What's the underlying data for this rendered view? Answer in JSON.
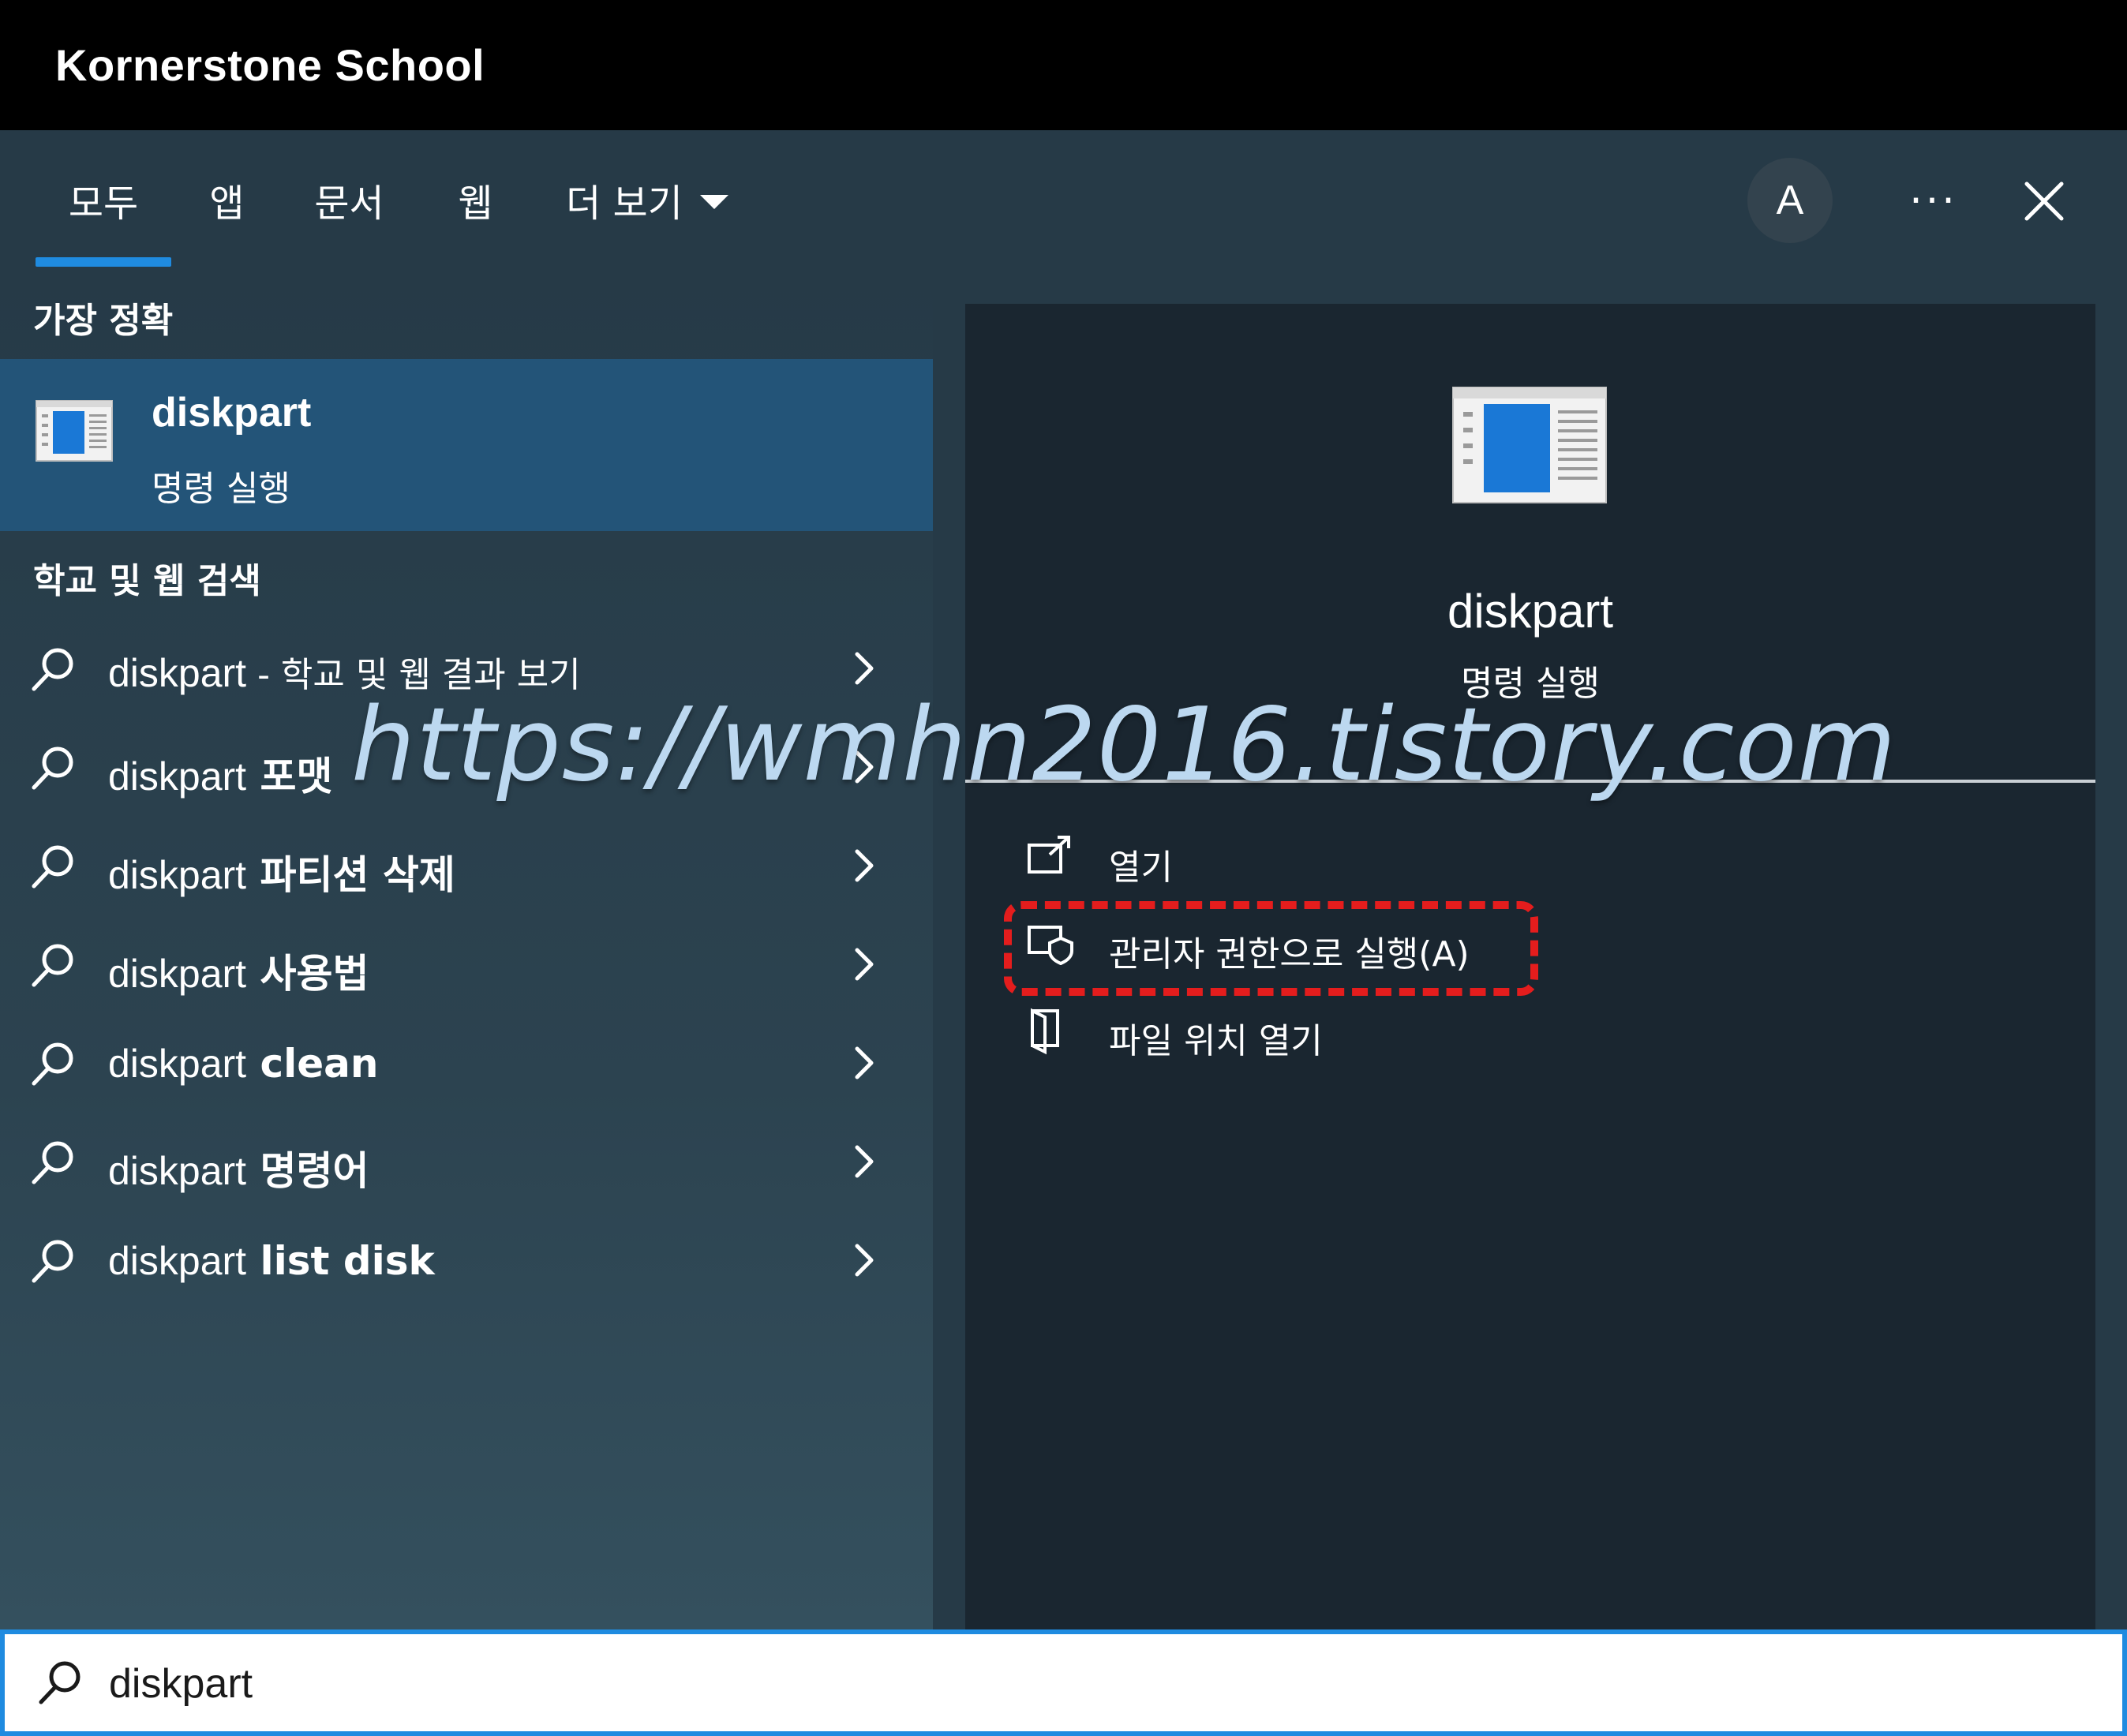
{
  "window": {
    "title": "Kornerstone School"
  },
  "tabs": [
    {
      "label": "모두",
      "active": true
    },
    {
      "label": "앱"
    },
    {
      "label": "문서"
    },
    {
      "label": "웹"
    },
    {
      "label": "더 보기",
      "has_dropdown": true
    }
  ],
  "header": {
    "avatar_initial": "A",
    "more_label": "···"
  },
  "best_match": {
    "heading": "가장 정확",
    "name": "diskpart",
    "subtitle": "명령 실행"
  },
  "web_search": {
    "heading": "학교 및 웹 검색",
    "results": [
      {
        "query": "diskpart",
        "suffix": " - 학교 및 웹 결과 보기",
        "suffix_style": "light"
      },
      {
        "query": "diskpart",
        "suffix": " 포맷",
        "suffix_style": "bold"
      },
      {
        "query": "diskpart",
        "suffix": " 파티션 삭제",
        "suffix_style": "bold"
      },
      {
        "query": "diskpart",
        "suffix": " 사용법",
        "suffix_style": "bold"
      },
      {
        "query": "diskpart",
        "suffix": " clean",
        "suffix_style": "bold"
      },
      {
        "query": "diskpart",
        "suffix": " 명령어",
        "suffix_style": "bold"
      },
      {
        "query": "diskpart",
        "suffix": " list disk",
        "suffix_style": "bold"
      }
    ]
  },
  "detail": {
    "name": "diskpart",
    "subtitle": "명령 실행",
    "actions": [
      {
        "label": "열기",
        "icon": "open-external-icon"
      },
      {
        "label": "관리자 권한으로 실행(A)",
        "icon": "run-as-admin-shield-icon",
        "highlighted": true
      },
      {
        "label": "파일 위치 열기",
        "icon": "folder-location-icon"
      }
    ]
  },
  "watermark": "https://wmhn2016.tistory.com",
  "search": {
    "value": "diskpart"
  },
  "colors": {
    "accent": "#1f8be0",
    "highlight_border": "#e41d1d",
    "selected_row": "#235478",
    "panel": "#263a47",
    "detail_card": "#1a2630"
  }
}
